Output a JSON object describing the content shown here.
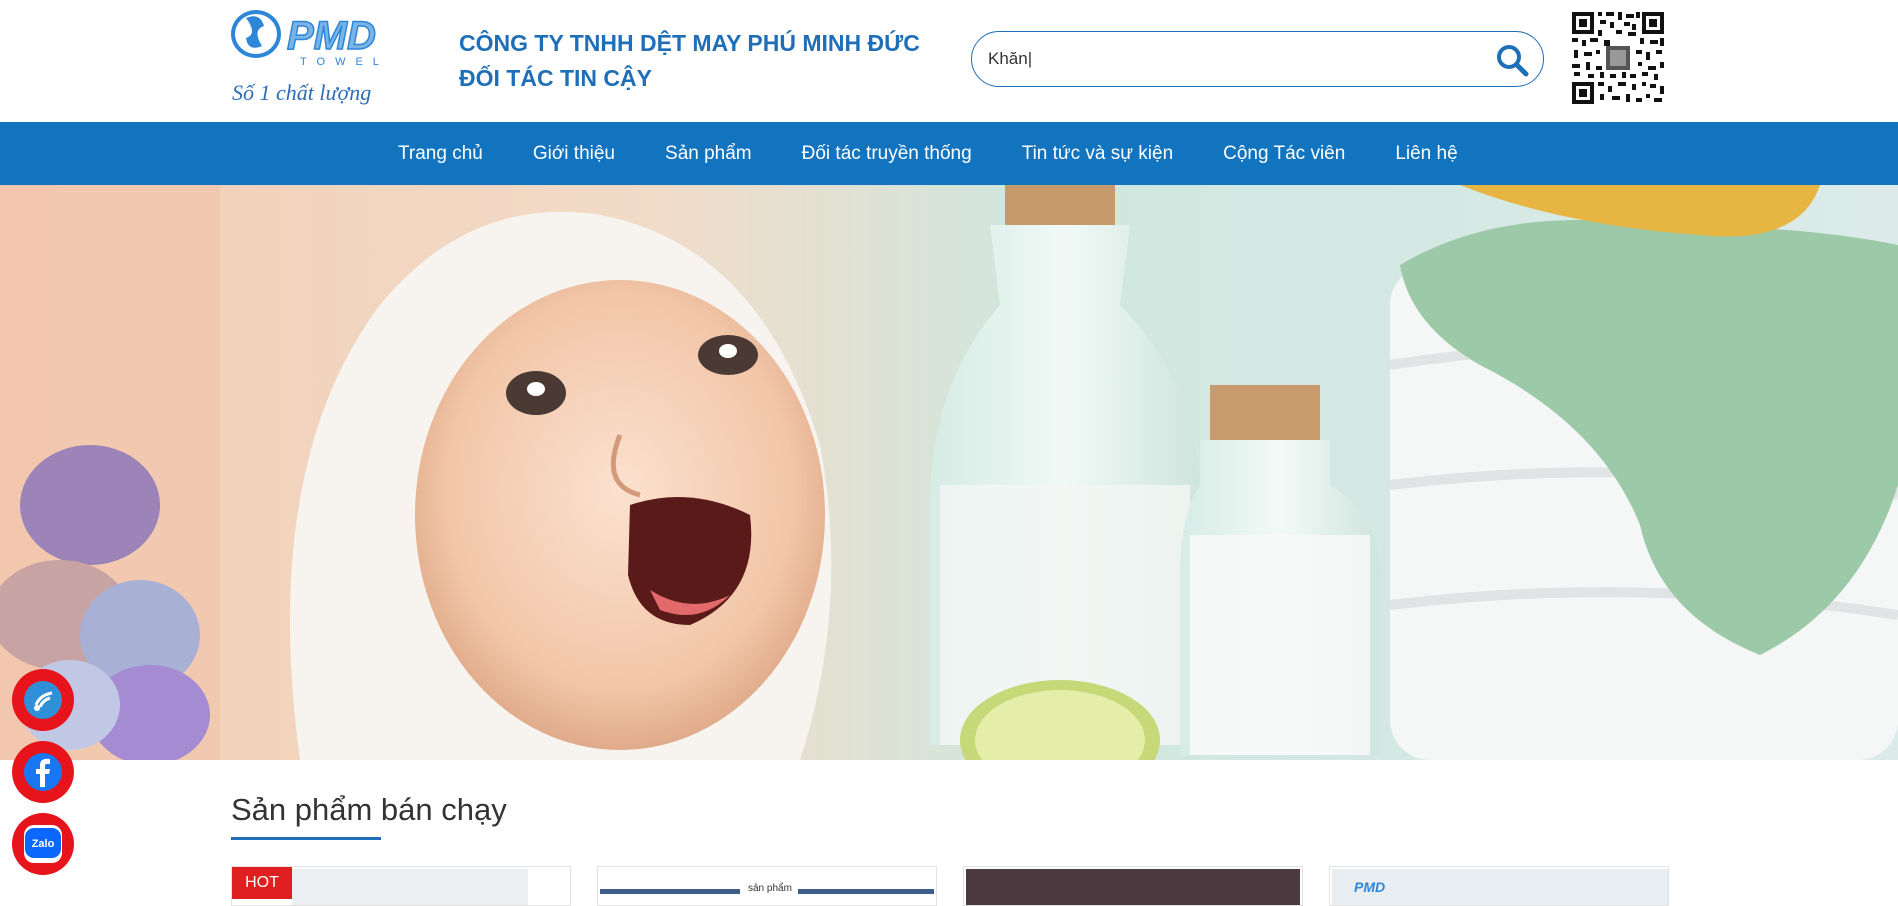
{
  "header": {
    "company_line1": "CÔNG TY TNHH DỆT MAY PHÚ MINH ĐỨC",
    "company_line2": "ĐỐI TÁC TIN CẬY",
    "logo_text": "PMD",
    "logo_sub": "TOWEL",
    "logo_slogan": "Số 1 chất lượng",
    "search_value": "Khăn|"
  },
  "nav": {
    "items": [
      {
        "label": "Trang chủ"
      },
      {
        "label": "Giới thiệu"
      },
      {
        "label": "Sản phẩm"
      },
      {
        "label": "Đối tác truyền thống"
      },
      {
        "label": "Tin tức và sự kiện"
      },
      {
        "label": "Cộng Tác viên"
      },
      {
        "label": "Liên hệ"
      }
    ]
  },
  "float_buttons": [
    {
      "icon": "phone-icon"
    },
    {
      "icon": "facebook-icon"
    },
    {
      "icon": "zalo-icon",
      "label": "Zalo"
    }
  ],
  "section": {
    "title": "Sản phẩm bán chạy"
  },
  "products": [
    {
      "badge": "HOT"
    },
    {
      "caption": "sản phẩm"
    },
    {},
    {
      "brand": "PMD"
    }
  ],
  "colors": {
    "brand_blue": "#1f6fb8",
    "nav_blue": "#1273be",
    "hot_red": "#e02020",
    "float_red": "#e7141b"
  }
}
